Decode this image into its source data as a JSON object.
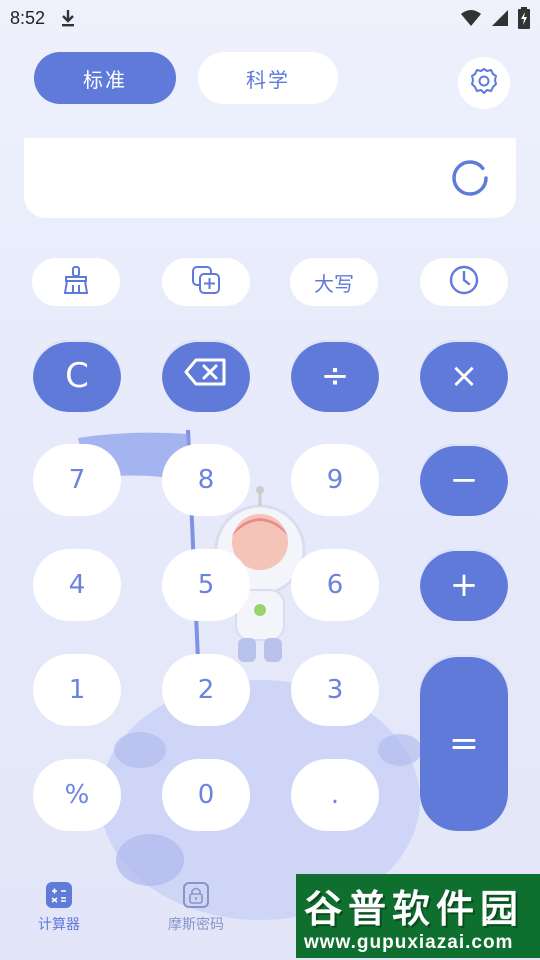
{
  "status_bar": {
    "time": "8:52",
    "icons": [
      "download-icon",
      "wifi-icon",
      "signal-icon",
      "battery-charging-icon"
    ]
  },
  "mode_tabs": [
    {
      "label": "标准",
      "selected": true
    },
    {
      "label": "科学",
      "selected": false
    }
  ],
  "settings_icon": "gear-icon",
  "display": {
    "loading_icon": "loading-ring-icon"
  },
  "toolbar": {
    "clear_history_icon": "broom-icon",
    "copy_icon": "copy-add-icon",
    "uppercase_label": "大写",
    "history_icon": "clock-icon"
  },
  "keys": {
    "clear": "C",
    "backspace_icon": "backspace-icon",
    "divide": "÷",
    "multiply": "×",
    "minus": "−",
    "plus": "+",
    "equals": "=",
    "seven": "7",
    "eight": "8",
    "nine": "9",
    "four": "4",
    "five": "5",
    "six": "6",
    "one": "1",
    "two": "2",
    "three": "3",
    "percent": "%",
    "zero": "0",
    "dot": "."
  },
  "bottom_nav": [
    {
      "label": "计算器",
      "icon": "calculator-icon",
      "active": true
    },
    {
      "label": "摩斯密码",
      "icon": "lock-icon",
      "active": false
    }
  ],
  "watermark": {
    "title": "谷普软件园",
    "url": "www.gupuxiazai.com"
  },
  "colors": {
    "accent": "#5f7ad9",
    "background": "#e8ecfb",
    "key_light": "#ffffff",
    "watermark_bg": "#0f6f2e"
  }
}
